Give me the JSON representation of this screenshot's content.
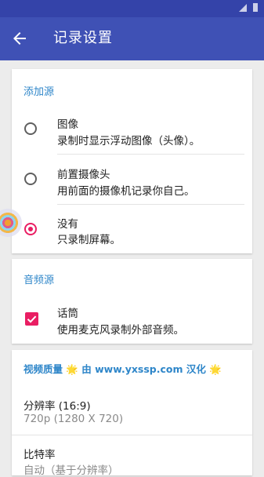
{
  "appbar": {
    "title": "记录设置"
  },
  "source_section": {
    "header": "添加源",
    "items": [
      {
        "title": "图像",
        "subtitle": "录制时显示浮动图像（头像）。",
        "selected": false
      },
      {
        "title": "前置摄像头",
        "subtitle": "用前面的摄像机记录你自己。",
        "selected": false
      },
      {
        "title": "没有",
        "subtitle": "只录制屏幕。",
        "selected": true
      }
    ]
  },
  "audio_section": {
    "header": "音频源",
    "item": {
      "title": "话筒",
      "subtitle": "使用麦克风录制外部音频。",
      "checked": true
    }
  },
  "video_section": {
    "header": "视频质量 🌟 由 www.yxssp.com 汉化 🌟",
    "items": [
      {
        "title": "分辨率 (16:9)",
        "subtitle": "720p (1280 X 720)"
      },
      {
        "title": "比特率",
        "subtitle": "自动（基于分辨率）"
      }
    ]
  },
  "colors": {
    "appbar": "#3f51b5",
    "statusbar": "#3443a9",
    "accent": "#e91e63",
    "section_header": "#2e86c9"
  }
}
